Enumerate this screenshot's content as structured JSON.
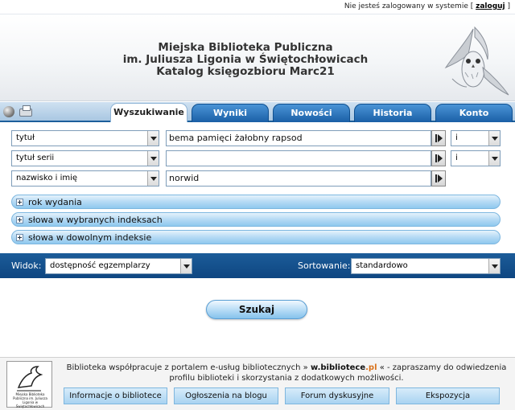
{
  "topbar": {
    "status_text": "Nie jesteś zalogowany w systemie",
    "login_link": "zaloguj"
  },
  "header": {
    "line1": "Miejska Biblioteka Publiczna",
    "line2": "im. Juliusza Ligonia w Świętochłowicach",
    "line3": "Katalog księgozbioru Marc21"
  },
  "tabs": [
    {
      "label": "Wyszukiwanie",
      "active": true
    },
    {
      "label": "Wyniki",
      "active": false
    },
    {
      "label": "Nowości",
      "active": false
    },
    {
      "label": "Historia",
      "active": false
    },
    {
      "label": "Konto",
      "active": false
    }
  ],
  "search_rows": [
    {
      "field": "tytuł",
      "value": "bema pamięci żałobny rapsod",
      "operator": "i"
    },
    {
      "field": "tytuł serii",
      "value": "",
      "operator": "i"
    },
    {
      "field": "nazwisko i imię",
      "value": "norwid",
      "operator": ""
    }
  ],
  "expanders": [
    "rok wydania",
    "słowa w wybranych indeksach",
    "słowa w dowolnym indeksie"
  ],
  "view": {
    "label": "Widok:",
    "value": "dostępność egzemplarzy"
  },
  "sort": {
    "label": "Sortowanie:",
    "value": "standardowo"
  },
  "search_button": "Szukaj",
  "footer": {
    "text_before": "Biblioteka współpracuje z portalem e-usług bibliotecznych »",
    "portal_name": "w.bibliotece",
    "portal_tld": ".pl",
    "text_after": "« - zapraszamy do odwiedzenia profilu biblioteki i skorzystania z dodatkowych możliwości.",
    "logo_text": "Miejska Biblioteka Publiczna im. Juliusza Ligonia w Świętochłowicach",
    "buttons": [
      "Informacje o bibliotece",
      "Ogłoszenia na blogu",
      "Forum dyskusyjne",
      "Ekspozycja"
    ]
  },
  "colors": {
    "tab_blue": "#1a5fa6",
    "view_bar": "#0e4681",
    "accent_orange": "#d9721b"
  }
}
